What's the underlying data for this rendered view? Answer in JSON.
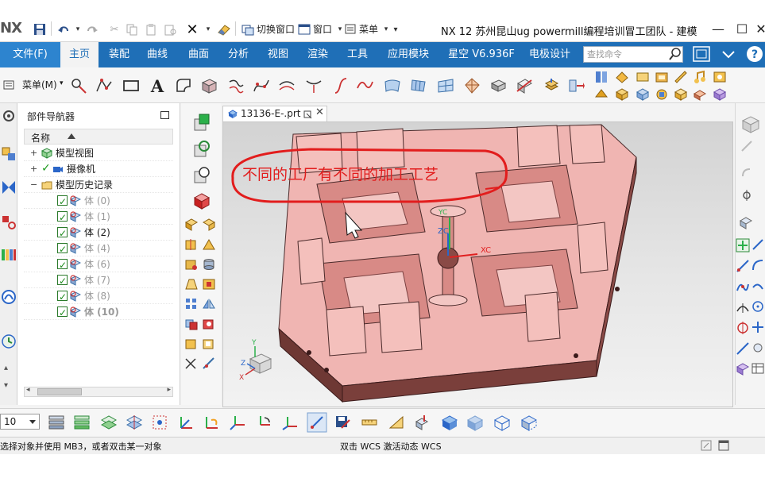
{
  "title_bar": {
    "logo": "NX",
    "switch_window": "切换窗口",
    "window_menu": "窗口",
    "menu_label": "菜单",
    "app_title": "NX 12 苏州昆山ug powermill编程培训冒工团队 - 建模"
  },
  "ribbon": {
    "file_tab": "文件(F)",
    "tabs": [
      "主页",
      "装配",
      "曲线",
      "曲面",
      "分析",
      "视图",
      "渲染",
      "工具",
      "应用模块",
      "星空 V6.936F",
      "电极设计"
    ],
    "active_tab": "主页",
    "search_placeholder": "查找命令",
    "menu_button": "菜单(M)"
  },
  "navigator": {
    "title": "部件导航器",
    "column_header": "名称",
    "tree": {
      "model_views": "模型视图",
      "camera": "摄像机",
      "history": "模型历史记录",
      "bodies": [
        "体 (0)",
        "体 (1)",
        "体 (2)",
        "体 (4)",
        "体 (6)",
        "体 (7)",
        "体 (8)",
        "体 (10)"
      ]
    }
  },
  "graphics": {
    "tab_label": "13136-E-.prt",
    "annotation": "不同的工厂有不同的加工工艺",
    "axes": {
      "yc": "YC",
      "zc": "ZC",
      "xc": "XC",
      "triad_y": "Y",
      "triad_z": "Z",
      "triad_x": "X"
    }
  },
  "bottom_toolbar": {
    "zoom_value": "10"
  },
  "status_bar": {
    "left": "选择对象并使用 MB3，或者双击某一对象",
    "center": "双击 WCS 激活动态 WCS"
  },
  "colors": {
    "ribbon_blue": "#1f6fb7",
    "part_face": "#f0b5b2",
    "part_shadow": "#7a3f3b",
    "annotation_red": "#e21d1d"
  }
}
